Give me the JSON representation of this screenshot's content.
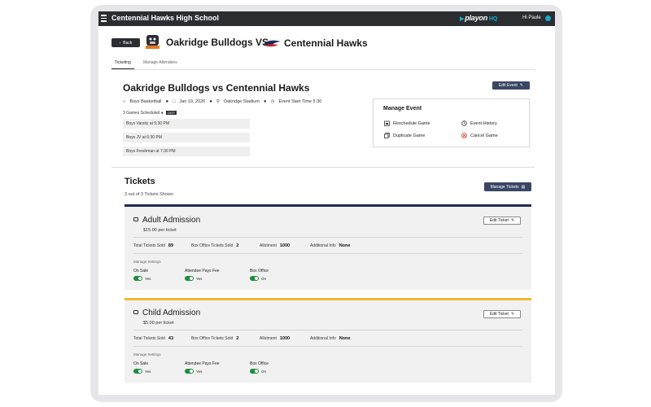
{
  "header": {
    "school_name": "Centennial Hawks High School",
    "brand": "playon",
    "brand_suffix": "HQ",
    "greeting": "Hi Paule"
  },
  "matchup": {
    "back_label": "Back",
    "home_team": "Oakridge Bulldogs VS",
    "away_team": "Centennial Hawks"
  },
  "tabs": [
    {
      "label": "Ticketing",
      "active": true
    },
    {
      "label": "Manage Attendees",
      "active": false
    }
  ],
  "event": {
    "title": "Oakridge Bulldogs vs Centennial Hawks",
    "edit_label": "Edit Event",
    "sport": "Boys Basketball",
    "date": "Jan 19, 2026",
    "venue": "Oakridge Stadium",
    "start_time": "Event Start Time 5:30",
    "games_scheduled": "3 Games Scheduled",
    "games_badge": "DIST",
    "games": [
      "Boys Varsity at 5:30 PM",
      "Boys JV at 6:30 PM",
      "Boys Freshman at 7:30 PM"
    ]
  },
  "manage_event": {
    "title": "Manage Event",
    "reschedule": "Reschedule Game",
    "history": "Event History",
    "duplicate": "Duplicate Game",
    "cancel": "Cancel Game"
  },
  "tickets": {
    "title": "Tickets",
    "count_text": "3 out of 3 Tickets Shown",
    "manage_label": "Manage Tickets",
    "edit_label": "Edit Ticket",
    "stat_labels": {
      "total_sold": "Total Tickets Sold",
      "box_office_sold": "Box Office Tickets Sold",
      "allotment": "Allotment",
      "additional_info": "Additional Info"
    },
    "manage_settings_label": "Manage Settings",
    "setting_labels": {
      "on_sale": "On Sale",
      "attendee_pays_fee": "Attendee Pays Fee",
      "box_office": "Box Office"
    },
    "items": [
      {
        "name": "Adult Admission",
        "price": "$15.00 per ticket",
        "accent": "#1f2a55",
        "total_sold": "89",
        "box_office_sold": "2",
        "allotment": "1000",
        "additional_info": "None",
        "on_sale": "Yes",
        "attendee_pays_fee": "Yes",
        "box_office": "On"
      },
      {
        "name": "Child Admission",
        "price": "$5.00 per ticket",
        "accent": "#f5b731",
        "total_sold": "43",
        "box_office_sold": "2",
        "allotment": "1000",
        "additional_info": "None",
        "on_sale": "Yes",
        "attendee_pays_fee": "Yes",
        "box_office": "On"
      }
    ]
  },
  "colors": {
    "topbar": "#2b2d31",
    "primary_button": "#3a4764",
    "toggle_on": "#1e8e3e",
    "brand_accent": "#19a7ce",
    "cancel_red": "#d93025"
  }
}
